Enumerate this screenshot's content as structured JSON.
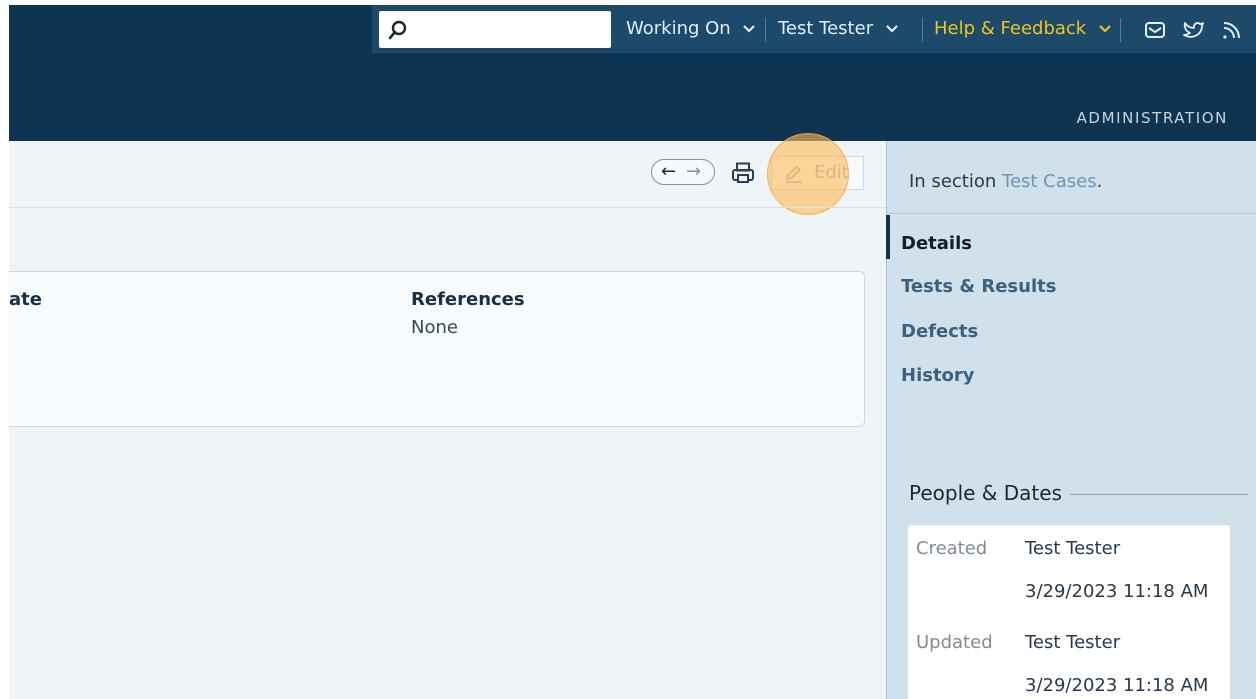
{
  "header": {
    "search_placeholder": "",
    "menus": [
      {
        "label": "Working On"
      },
      {
        "label": "Test Tester"
      },
      {
        "label": "Help & Feedback"
      }
    ],
    "icons": [
      "mail-icon",
      "twitter-icon",
      "rss-icon"
    ],
    "section_link": "ADMINISTRATION"
  },
  "toolbar": {
    "back_symbol": "←",
    "forward_symbol": "→",
    "edit_label": "Edit"
  },
  "detail_card": {
    "column_left_header": "ate",
    "column_references_header": "References",
    "references_value": "None"
  },
  "sidebar": {
    "section_prefix": "In section",
    "section_link": "Test Cases",
    "section_suffix": ".",
    "tabs": [
      {
        "label": "Details",
        "active": true
      },
      {
        "label": "Tests & Results"
      },
      {
        "label": "Defects"
      },
      {
        "label": "History"
      }
    ],
    "people_title": "People & Dates",
    "people": [
      {
        "label": "Created",
        "name": "Test Tester",
        "date": "3/29/2023 11:18 AM"
      },
      {
        "label": "Updated",
        "name": "Test Tester",
        "date": "3/29/2023 11:18 AM"
      }
    ]
  },
  "colors": {
    "header_dark": "#0f3451",
    "header_bar": "#1d4a6b",
    "accent_yellow": "#f3c21c",
    "highlight": "#fcbc58"
  }
}
